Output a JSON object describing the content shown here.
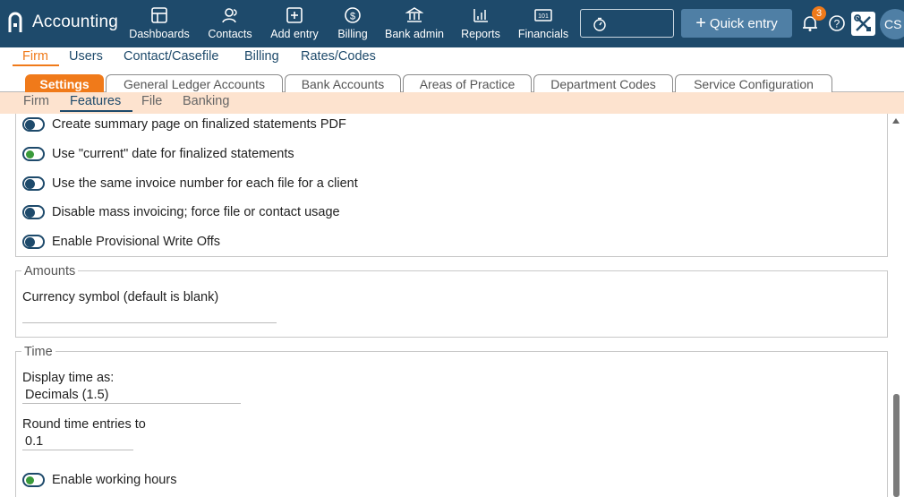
{
  "app": {
    "title": "Accounting",
    "nav": [
      {
        "label": "Dashboards",
        "icon": "dashboard-icon"
      },
      {
        "label": "Contacts",
        "icon": "contacts-icon"
      },
      {
        "label": "Add entry",
        "icon": "add-entry-icon"
      },
      {
        "label": "Billing",
        "icon": "billing-icon"
      },
      {
        "label": "Bank admin",
        "icon": "bank-icon"
      },
      {
        "label": "Reports",
        "icon": "reports-icon"
      },
      {
        "label": "Financials",
        "icon": "financials-icon"
      }
    ],
    "quick_entry_label": "Quick entry",
    "notification_count": "3",
    "avatar_initials": "CS"
  },
  "subnav": {
    "items": [
      "Firm",
      "Users",
      "Contact/Casefile",
      "Billing",
      "Rates/Codes"
    ],
    "active": "Firm"
  },
  "tabs": {
    "items": [
      "Settings",
      "General Ledger Accounts",
      "Bank Accounts",
      "Areas of Practice",
      "Department Codes",
      "Service Configuration"
    ],
    "active": "Settings"
  },
  "subtabs": {
    "items": [
      "Firm",
      "Features",
      "File",
      "Banking"
    ],
    "active": "Features"
  },
  "features": {
    "toggles": [
      {
        "label": "Create summary page on finalized statements PDF",
        "on": false
      },
      {
        "label": "Use \"current\" date for finalized statements",
        "on": true
      },
      {
        "label": "Use the same invoice number for each file for a client",
        "on": false
      },
      {
        "label": "Disable mass invoicing; force file or contact usage",
        "on": false
      },
      {
        "label": "Enable Provisional Write Offs",
        "on": false
      }
    ]
  },
  "amounts": {
    "legend": "Amounts",
    "currency_label": "Currency symbol (default is blank)",
    "currency_value": ""
  },
  "time": {
    "legend": "Time",
    "display_label": "Display time as:",
    "display_value": "Decimals (1.5)",
    "round_label": "Round time entries to",
    "round_value": "0.1",
    "working_hours_label": "Enable working hours",
    "working_hours_on": true
  },
  "colors": {
    "topbar": "#1e4a6b",
    "accent": "#f07a1a",
    "peach": "#fde3cf",
    "toggle_on": "#3a9a3a"
  }
}
